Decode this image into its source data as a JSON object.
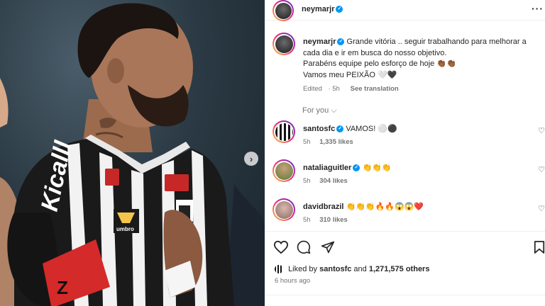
{
  "post": {
    "author": "neymarjr",
    "caption_lines": [
      "Grande vitória .. seguir trabalhando para melhorar a",
      "cada dia e ir em busca do nosso objetivo.",
      "Parabéns equipe pelo esforço de hoje 👏🏾👏🏾",
      "Vamos meu PEIXÃO 🤍🖤"
    ],
    "edited": "Edited",
    "time": "5h",
    "see_translation": "See translation"
  },
  "for_you": "For you",
  "comments": [
    {
      "user": "santosfc",
      "text": "VAMOS! ⚪⚫",
      "verified": true,
      "time": "5h",
      "likes": "1,335 likes"
    },
    {
      "user": "nataliaguitler",
      "text": "👏👏👏",
      "verified": true,
      "time": "5h",
      "likes": "304 likes"
    },
    {
      "user": "davidbrazil",
      "text": "👏👏👏🔥🔥😱😱❤️",
      "verified": false,
      "time": "5h",
      "likes": "310 likes"
    }
  ],
  "likes": {
    "prefix": "Liked by",
    "user": "santosfc",
    "and": "and",
    "count": "1,271,575 others"
  },
  "time_ago": "6 hours ago",
  "icons": {
    "more": "more-horizontal-icon",
    "next": "chevron-right-icon",
    "like": "heart-icon",
    "comment": "comment-icon",
    "share": "share-icon",
    "save": "bookmark-icon",
    "verified": "verified-badge-icon"
  },
  "colors": {
    "verified": "#0095f6",
    "muted": "#737373",
    "story_ring": "#ee2a7b",
    "armband": "#d42a2a"
  }
}
